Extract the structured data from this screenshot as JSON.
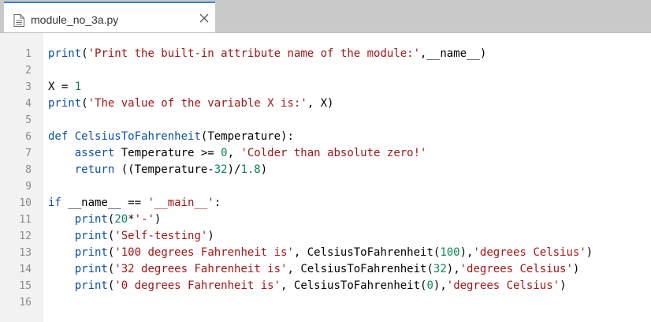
{
  "tab": {
    "filename": "module_no_3a.py",
    "file_icon": "document-icon",
    "close_icon": "close-icon"
  },
  "colors": {
    "keyword": "#0b4fa8",
    "string": "#a31515",
    "number": "#098658",
    "text": "#000000",
    "line_number": "#8a8a8a",
    "tab_accent": "#3a7fd4"
  },
  "editor": {
    "lines": [
      {
        "number": "1",
        "tokens": [
          {
            "t": "kw",
            "v": "print"
          },
          {
            "t": "plain",
            "v": "("
          },
          {
            "t": "str",
            "v": "'Print the built-in attribute name of the module:'"
          },
          {
            "t": "plain",
            "v": ",__name__)"
          }
        ]
      },
      {
        "number": "2",
        "tokens": []
      },
      {
        "number": "3",
        "tokens": [
          {
            "t": "plain",
            "v": "X = "
          },
          {
            "t": "num",
            "v": "1"
          }
        ]
      },
      {
        "number": "4",
        "tokens": [
          {
            "t": "kw",
            "v": "print"
          },
          {
            "t": "plain",
            "v": "("
          },
          {
            "t": "str",
            "v": "'The value of the variable X is:'"
          },
          {
            "t": "plain",
            "v": ", X)"
          }
        ]
      },
      {
        "number": "5",
        "tokens": []
      },
      {
        "number": "6",
        "tokens": [
          {
            "t": "kw",
            "v": "def"
          },
          {
            "t": "plain",
            "v": " "
          },
          {
            "t": "fn",
            "v": "CelsiusToFahrenheit"
          },
          {
            "t": "plain",
            "v": "(Temperature):"
          }
        ]
      },
      {
        "number": "7",
        "tokens": [
          {
            "t": "plain",
            "v": "    "
          },
          {
            "t": "kw",
            "v": "assert"
          },
          {
            "t": "plain",
            "v": " Temperature >= "
          },
          {
            "t": "num",
            "v": "0"
          },
          {
            "t": "plain",
            "v": ", "
          },
          {
            "t": "str",
            "v": "'Colder than absolute zero!'"
          }
        ]
      },
      {
        "number": "8",
        "tokens": [
          {
            "t": "plain",
            "v": "    "
          },
          {
            "t": "kw",
            "v": "return"
          },
          {
            "t": "plain",
            "v": " ((Temperature-"
          },
          {
            "t": "num",
            "v": "32"
          },
          {
            "t": "plain",
            "v": ")/"
          },
          {
            "t": "num",
            "v": "1.8"
          },
          {
            "t": "plain",
            "v": ")"
          }
        ]
      },
      {
        "number": "9",
        "tokens": []
      },
      {
        "number": "10",
        "tokens": [
          {
            "t": "kw",
            "v": "if"
          },
          {
            "t": "plain",
            "v": " __name__ == "
          },
          {
            "t": "str",
            "v": "'__main__'"
          },
          {
            "t": "plain",
            "v": ":"
          }
        ]
      },
      {
        "number": "11",
        "tokens": [
          {
            "t": "plain",
            "v": "    "
          },
          {
            "t": "kw",
            "v": "print"
          },
          {
            "t": "plain",
            "v": "("
          },
          {
            "t": "num",
            "v": "20"
          },
          {
            "t": "plain",
            "v": "*"
          },
          {
            "t": "str",
            "v": "'-'"
          },
          {
            "t": "plain",
            "v": ")"
          }
        ]
      },
      {
        "number": "12",
        "tokens": [
          {
            "t": "plain",
            "v": "    "
          },
          {
            "t": "kw",
            "v": "print"
          },
          {
            "t": "plain",
            "v": "("
          },
          {
            "t": "str",
            "v": "'Self-testing'"
          },
          {
            "t": "plain",
            "v": ")"
          }
        ]
      },
      {
        "number": "13",
        "tokens": [
          {
            "t": "plain",
            "v": "    "
          },
          {
            "t": "kw",
            "v": "print"
          },
          {
            "t": "plain",
            "v": "("
          },
          {
            "t": "str",
            "v": "'100 degrees Fahrenheit is'"
          },
          {
            "t": "plain",
            "v": ", CelsiusToFahrenheit("
          },
          {
            "t": "num",
            "v": "100"
          },
          {
            "t": "plain",
            "v": "),"
          },
          {
            "t": "str",
            "v": "'degrees Celsius'"
          },
          {
            "t": "plain",
            "v": ")"
          }
        ]
      },
      {
        "number": "14",
        "tokens": [
          {
            "t": "plain",
            "v": "    "
          },
          {
            "t": "kw",
            "v": "print"
          },
          {
            "t": "plain",
            "v": "("
          },
          {
            "t": "str",
            "v": "'32 degrees Fahrenheit is'"
          },
          {
            "t": "plain",
            "v": ", CelsiusToFahrenheit("
          },
          {
            "t": "num",
            "v": "32"
          },
          {
            "t": "plain",
            "v": "),"
          },
          {
            "t": "str",
            "v": "'degrees Celsius'"
          },
          {
            "t": "plain",
            "v": ")"
          }
        ]
      },
      {
        "number": "15",
        "tokens": [
          {
            "t": "plain",
            "v": "    "
          },
          {
            "t": "kw",
            "v": "print"
          },
          {
            "t": "plain",
            "v": "("
          },
          {
            "t": "str",
            "v": "'0 degrees Fahrenheit is'"
          },
          {
            "t": "plain",
            "v": ", CelsiusToFahrenheit("
          },
          {
            "t": "num",
            "v": "0"
          },
          {
            "t": "plain",
            "v": "),"
          },
          {
            "t": "str",
            "v": "'degrees Celsius'"
          },
          {
            "t": "plain",
            "v": ")"
          }
        ]
      },
      {
        "number": "16",
        "tokens": []
      }
    ]
  }
}
